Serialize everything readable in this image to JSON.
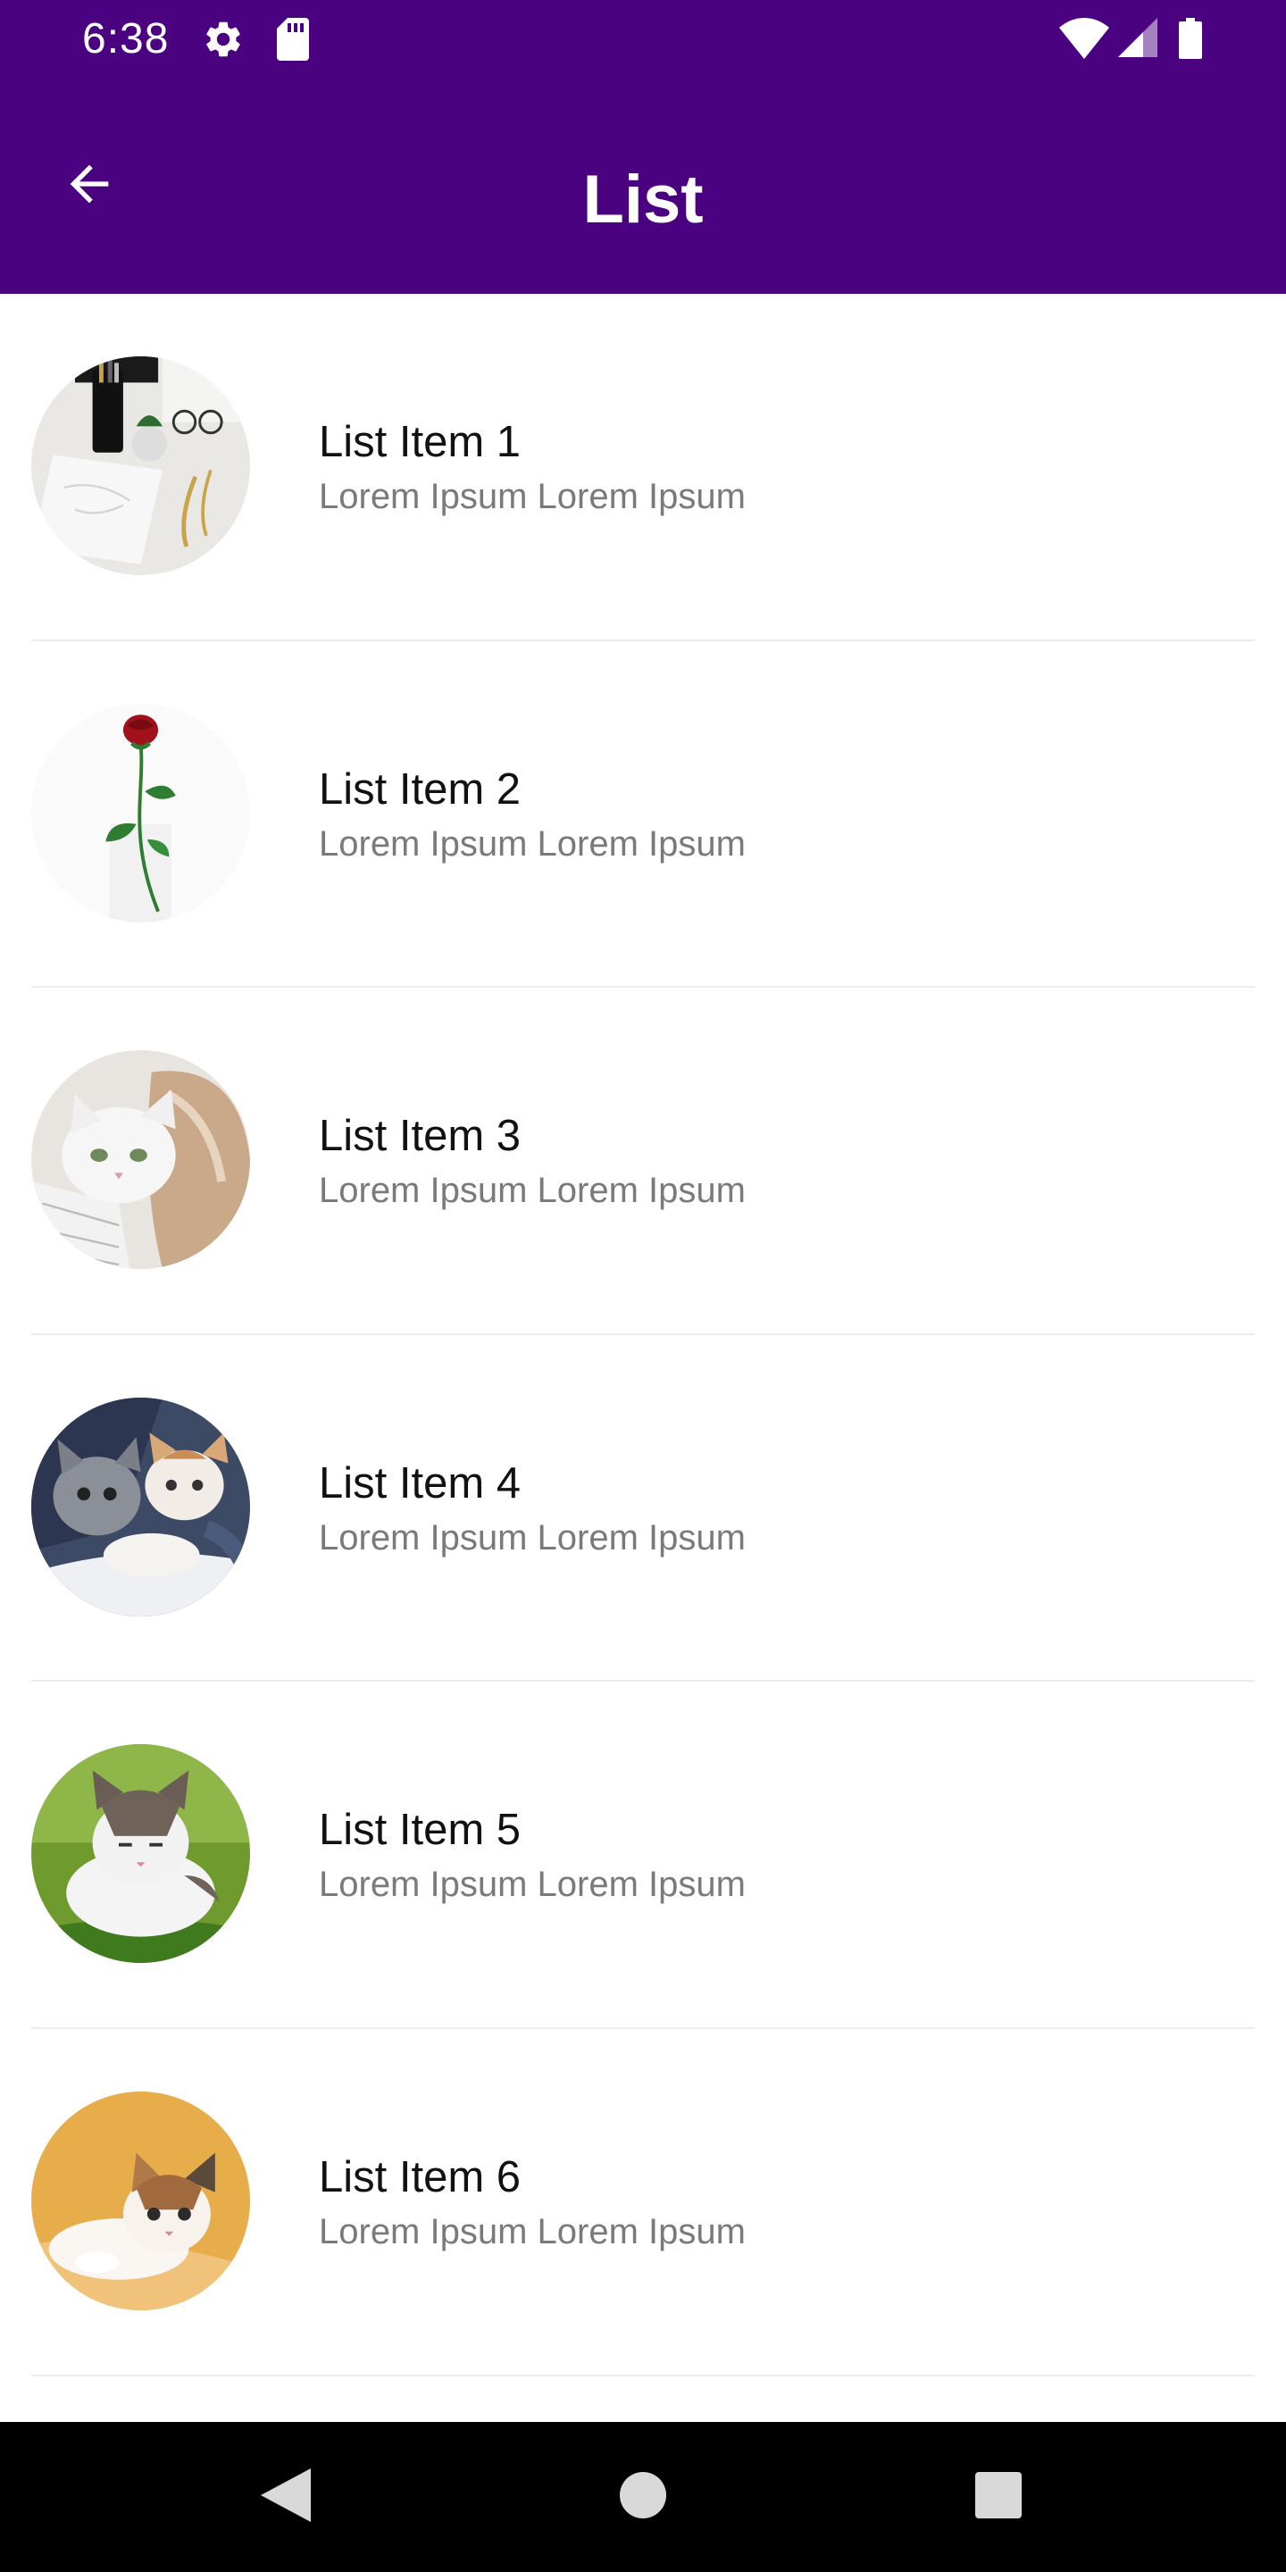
{
  "status_bar": {
    "time": "6:38",
    "icons": [
      "gear-icon",
      "sd-card-icon",
      "wifi-icon",
      "cell-signal-icon",
      "battery-icon"
    ]
  },
  "app_bar": {
    "title": "List",
    "back_icon": "arrow-left-icon",
    "background": "#4a0280"
  },
  "list": {
    "items": [
      {
        "title": "List Item 1",
        "subtitle": "Lorem Ipsum Lorem Ipsum",
        "image": "desk-workspace"
      },
      {
        "title": "List Item 2",
        "subtitle": "Lorem Ipsum Lorem Ipsum",
        "image": "red-rose"
      },
      {
        "title": "List Item 3",
        "subtitle": "Lorem Ipsum Lorem Ipsum",
        "image": "white-kitten"
      },
      {
        "title": "List Item 4",
        "subtitle": "Lorem Ipsum Lorem Ipsum",
        "image": "kittens-on-jeans"
      },
      {
        "title": "List Item 5",
        "subtitle": "Lorem Ipsum Lorem Ipsum",
        "image": "cat-on-grass"
      },
      {
        "title": "List Item 6",
        "subtitle": "Lorem Ipsum Lorem Ipsum",
        "image": "kitten-orange-background"
      }
    ]
  },
  "nav_bar": {
    "buttons": [
      "back-triangle-icon",
      "home-circle-icon",
      "recents-square-icon"
    ]
  }
}
